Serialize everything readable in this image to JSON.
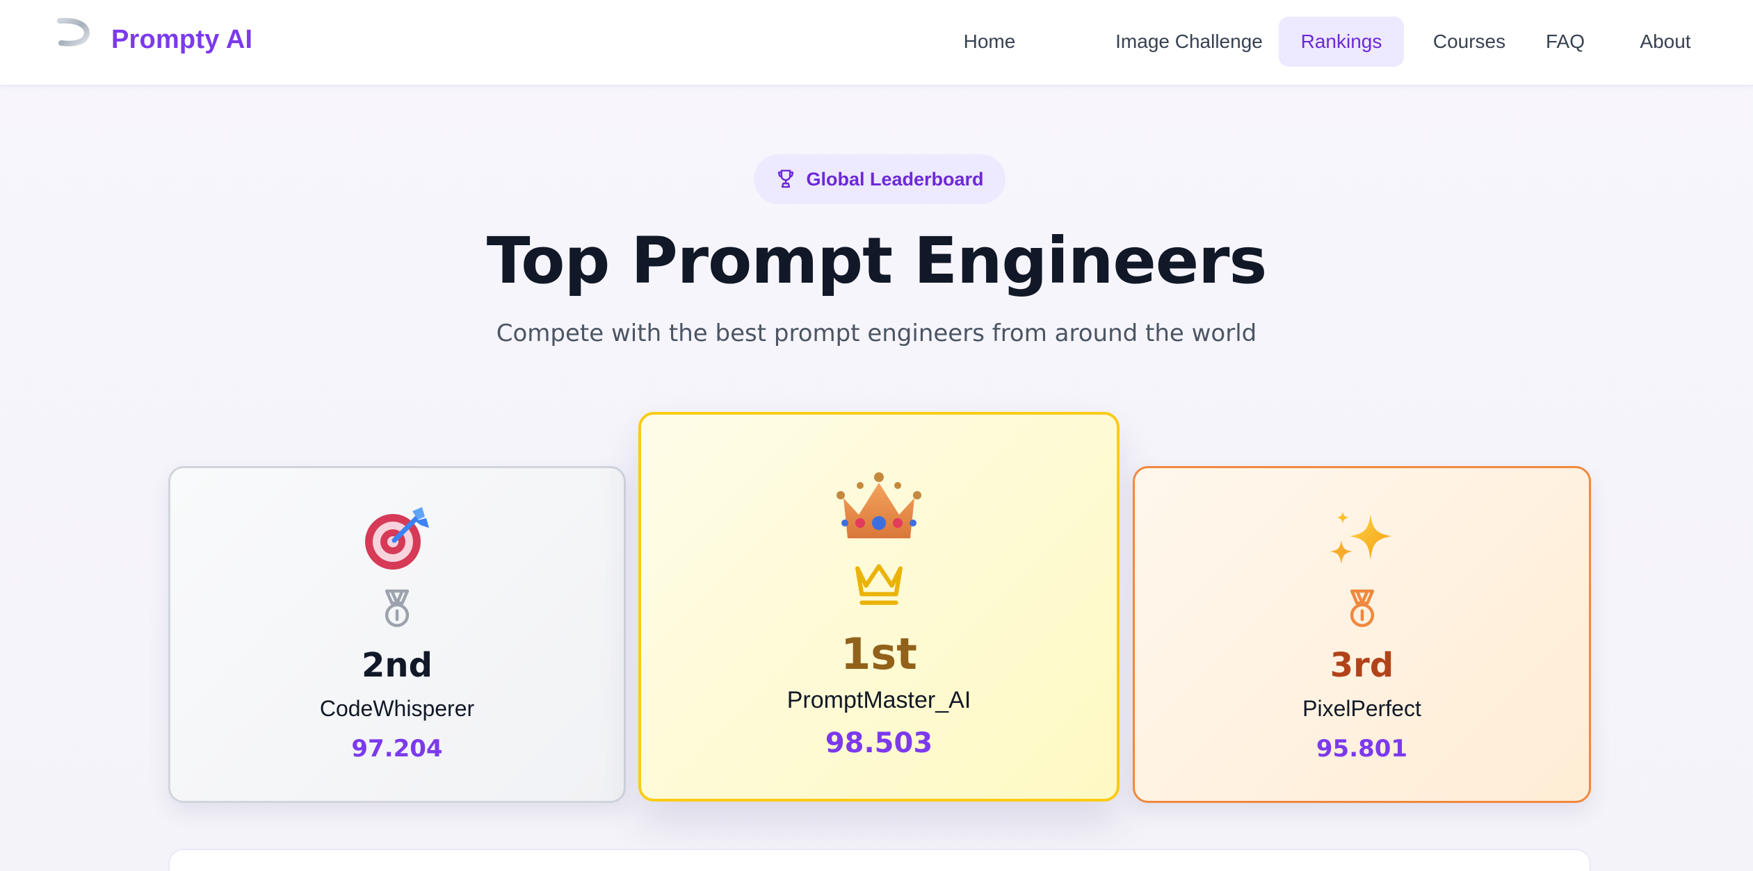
{
  "app": {
    "brand": "Prompty AI"
  },
  "nav": {
    "items": [
      {
        "label": "Home",
        "active": false
      },
      {
        "label": "Image Challenge",
        "active": false
      },
      {
        "label": "Rankings",
        "active": true
      },
      {
        "label": "Courses",
        "active": false
      },
      {
        "label": "FAQ",
        "active": false
      },
      {
        "label": "About",
        "active": false
      }
    ]
  },
  "hero": {
    "badge": "Global Leaderboard",
    "badge_icon": "trophy-icon",
    "title": "Top Prompt Engineers",
    "subtitle": "Compete with the best prompt engineers from around the world"
  },
  "podium": {
    "second": {
      "emoji": "🎯",
      "medal_icon": "medal-icon",
      "rank": "2nd",
      "name": "CodeWhisperer",
      "score": "97.204",
      "rank_color": "#374151",
      "accent": "#9ca3af"
    },
    "first": {
      "emoji": "👑",
      "medal_icon": "crown-icon",
      "rank": "1st",
      "name": "PromptMaster_AI",
      "score": "98.503",
      "rank_color": "#92611a",
      "accent": "#eab308"
    },
    "third": {
      "emoji": "✨",
      "medal_icon": "medal-icon",
      "rank": "3rd",
      "name": "PixelPerfect",
      "score": "95.801",
      "rank_color": "#b1431a",
      "accent": "#f0883e"
    }
  },
  "colors": {
    "brand": "#7c3aed",
    "active_nav_bg": "#ede9fe"
  }
}
